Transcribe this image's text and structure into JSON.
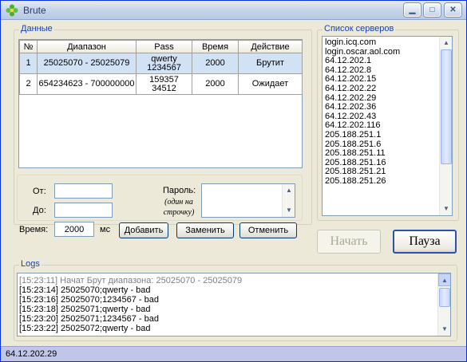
{
  "window": {
    "title": "Brute"
  },
  "data_group": {
    "legend": "Данные",
    "table": {
      "headers": [
        "№",
        "Диапазон",
        "Pass",
        "Время",
        "Действие"
      ],
      "rows": [
        {
          "num": "1",
          "range": "25025070 - 25025079",
          "pass1": "qwerty",
          "pass2": "1234567",
          "time": "2000",
          "action": "Брутит",
          "selected": true
        },
        {
          "num": "2",
          "range": "654234623 - 700000000",
          "pass1": "159357",
          "pass2": "34512",
          "time": "2000",
          "action": "Ожидает",
          "selected": false
        }
      ]
    },
    "form": {
      "from_label": "От:",
      "from_value": "",
      "to_label": "До:",
      "to_value": "",
      "time_label": "Время:",
      "time_value": "2000",
      "time_unit": "мс",
      "password_label": "Пароль:",
      "password_hint": "(один на строчку)",
      "add_button": "Добавить",
      "replace_button": "Заменить",
      "cancel_button": "Отменить"
    }
  },
  "servers_group": {
    "legend": "Список серверов",
    "items": [
      "login.icq.com",
      "login.oscar.aol.com",
      "64.12.202.1",
      "64.12.202.8",
      "64.12.202.15",
      "64.12.202.22",
      "64.12.202.29",
      "64.12.202.36",
      "64.12.202.43",
      "64.12.202.116",
      "205.188.251.1",
      "205.188.251.6",
      "205.188.251.11",
      "205.188.251.16",
      "205.188.251.21",
      "205.188.251.26"
    ]
  },
  "controls": {
    "start_button": "Начать",
    "pause_button": "Пауза"
  },
  "logs_group": {
    "legend": "Logs",
    "lines": [
      "[15:23:11] Начат Брут диапазона: 25025070 - 25025079",
      "[15:23:14] 25025070;qwerty - bad",
      "[15:23:16] 25025070;1234567 - bad",
      "[15:23:18] 25025071;qwerty - bad",
      "[15:23:20] 25025071;1234567 - bad",
      "[15:23:22] 25025072;qwerty - bad"
    ]
  },
  "status": {
    "text": "64.12.202.29"
  },
  "colors": {
    "accent": "#1a3fb0",
    "selection": "#d1e2f5",
    "statusbar": "#c1c5e8"
  }
}
